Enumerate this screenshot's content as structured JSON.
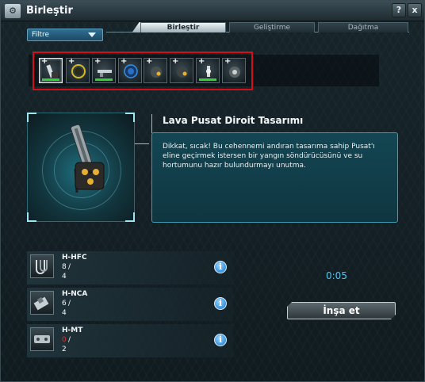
{
  "window": {
    "title": "Birleştir",
    "help_label": "?",
    "close_label": "x"
  },
  "filter": {
    "label": "Filtre"
  },
  "tabs": [
    {
      "label": "Birleştir",
      "active": true
    },
    {
      "label": "Geliştirme",
      "active": false
    },
    {
      "label": "Dağıtma",
      "active": false
    }
  ],
  "items": [
    {
      "name": "lava-pusat-blueprint",
      "selected": true,
      "progress": 0.85
    },
    {
      "name": "yellow-ring-blueprint",
      "selected": false,
      "progress": 0
    },
    {
      "name": "rifle-blueprint",
      "selected": false,
      "progress": 0.85
    },
    {
      "name": "blue-sphere-blueprint",
      "selected": false,
      "progress": 0
    },
    {
      "name": "droid-core-blueprint",
      "selected": false,
      "progress": 0
    },
    {
      "name": "droid-core-alt-blueprint",
      "selected": false,
      "progress": 0
    },
    {
      "name": "beacon-blueprint",
      "selected": false,
      "progress": 0.85
    },
    {
      "name": "droid-small-blueprint",
      "selected": false,
      "progress": 0
    }
  ],
  "selected_item": {
    "title": "Lava Pusat Diroit Tasarımı",
    "description": "Dikkat, sıcak! Bu cehennemi andıran tasarıma sahip Pusat'ı eline geçirmek istersen bir yangın söndürücüsünü ve su hortumunu hazır bulundurmayı unutma."
  },
  "requirements": [
    {
      "name": "H-HFC",
      "have": "8",
      "need": "4",
      "short": false,
      "info_label": "i"
    },
    {
      "name": "H-NCA",
      "have": "6",
      "need": "4",
      "short": false,
      "info_label": "i"
    },
    {
      "name": "H-MT",
      "have": "0",
      "need": "2",
      "short": true,
      "info_label": "i"
    }
  ],
  "craft": {
    "timer": "0:05",
    "build_label": "İnşa et"
  },
  "colors": {
    "accent": "#52c3ea",
    "highlight_box": "#d3101a",
    "progress": "#34d135",
    "shortage": "#e0352e"
  }
}
